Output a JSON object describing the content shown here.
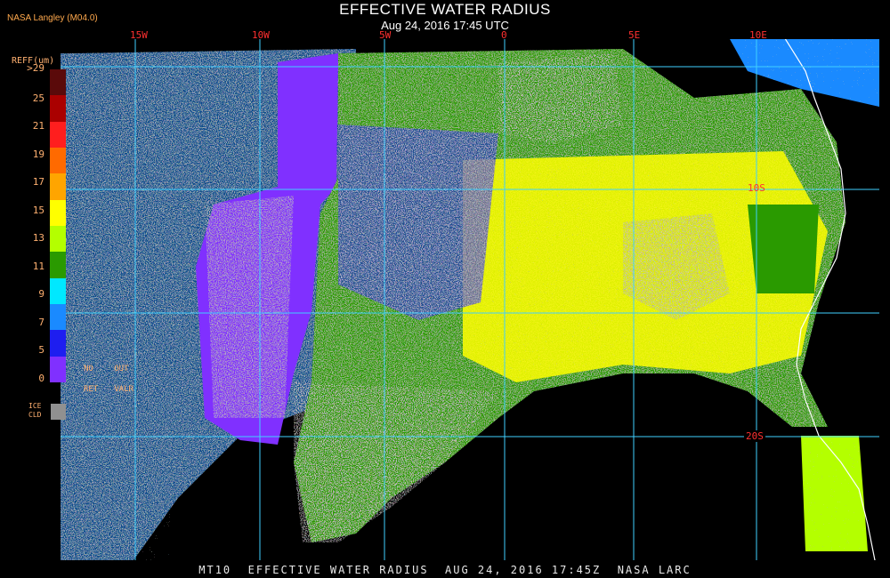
{
  "header": {
    "title": "EFFECTIVE WATER RADIUS",
    "subtitle": "Aug 24, 2016 17:45 UTC",
    "producer": "NASA Langley (M04.0)"
  },
  "legend": {
    "title": "REFF(um)",
    "ticks": [
      ">29",
      "25",
      "21",
      "19",
      "17",
      "15",
      "13",
      "11",
      "9",
      "7",
      "5",
      "0"
    ],
    "colors": [
      "#5a0a0a",
      "#aa0000",
      "#ff1e1e",
      "#ff6a00",
      "#ffa500",
      "#ffff00",
      "#b4ff00",
      "#2a9a00",
      "#00e8ff",
      "#1a8aff",
      "#1e1ef0",
      "#8030ff"
    ],
    "no_ret": "NO\nRET",
    "out_valr": "OUT\nVALR",
    "ice_label": "ICE\nCLD",
    "ice_color": "#909090"
  },
  "grid": {
    "longitude_labels": [
      "15W",
      "10W",
      "5W",
      "0",
      "5E",
      "10E"
    ],
    "latitude_labels": [
      "10S",
      "20S"
    ],
    "line_color": "#40d0ff",
    "label_color": "#ff3030"
  },
  "footer": {
    "text": "MT10  EFFECTIVE WATER RADIUS  AUG 24, 2016 17:45Z  NASA LARC"
  }
}
